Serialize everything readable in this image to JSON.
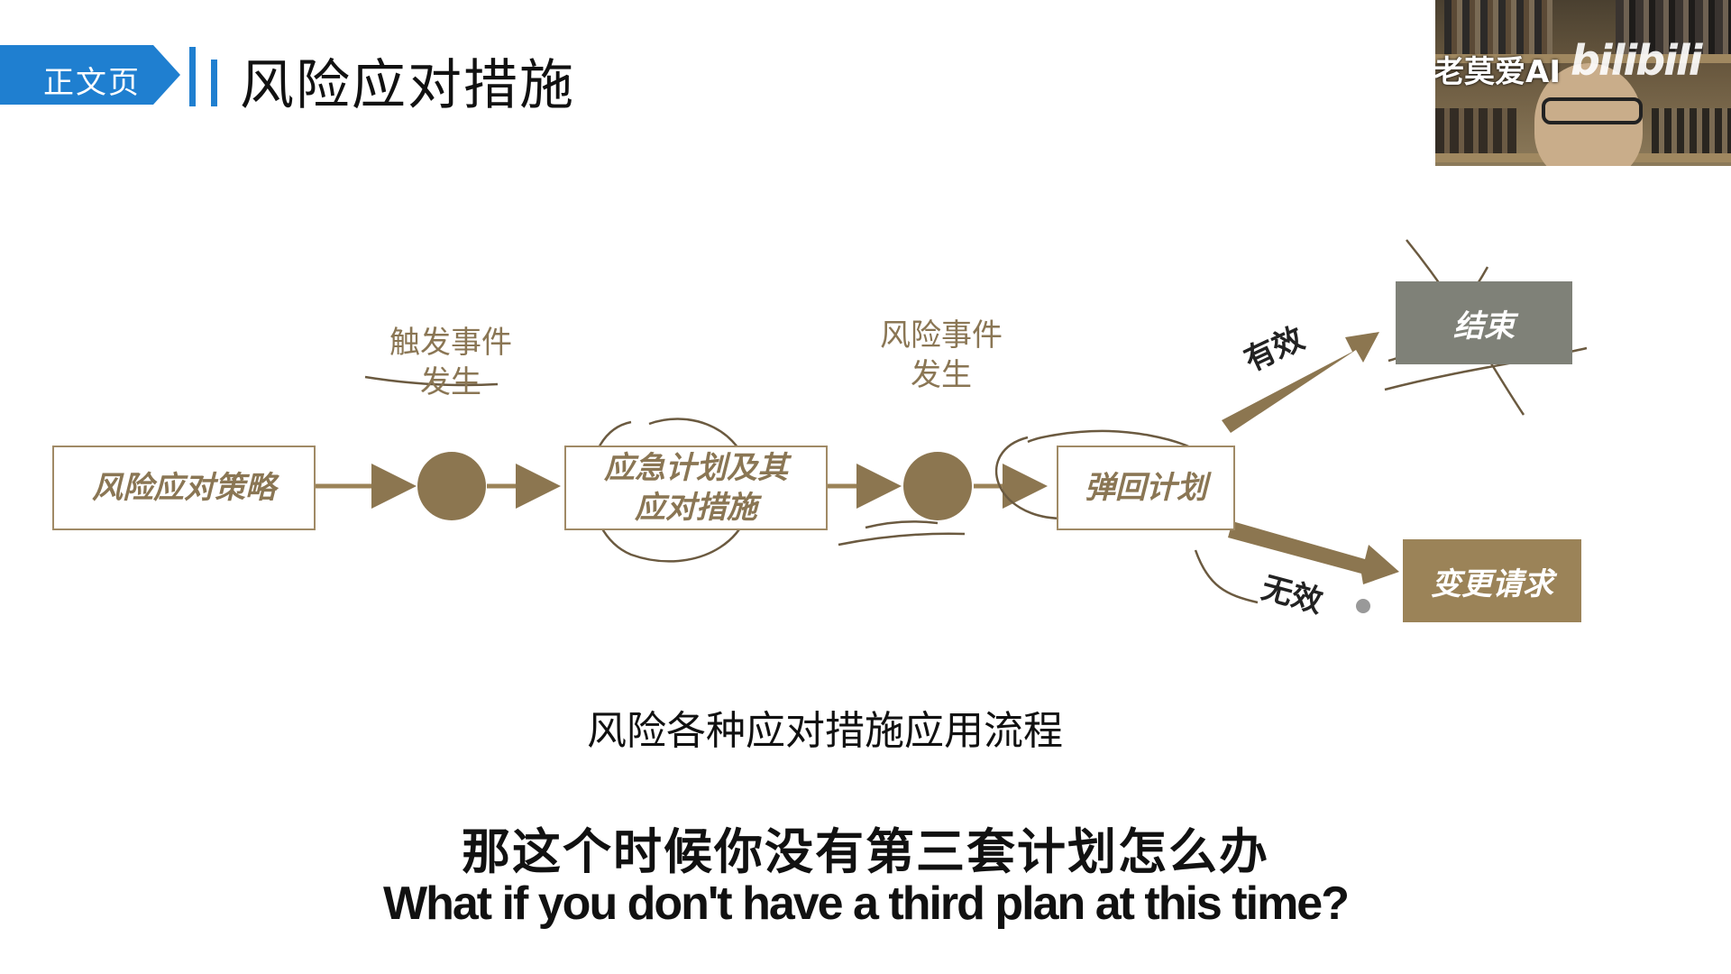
{
  "header": {
    "tag": "正文页",
    "title": "风险应对措施"
  },
  "webcam": {
    "owner": "老莫爱AI",
    "logo": "bilibili"
  },
  "diagram": {
    "box1": "风险应对策略",
    "trigger_label_line1": "触发事件",
    "trigger_label_line2": "发生",
    "box2_line1": "应急计划及其",
    "box2_line2": "应对措施",
    "risk_label_line1": "风险事件",
    "risk_label_line2": "发生",
    "box3": "弹回计划",
    "effective": "有效",
    "ineffective": "无效",
    "end": "结束",
    "change": "变更请求",
    "caption": "风险各种应对措施应用流程"
  },
  "subtitles": {
    "zh": "那这个时候你没有第三套计划怎么办",
    "en": "What if you don't have a third plan at this time?"
  },
  "colors": {
    "accent": "#1f7fd0",
    "brown": "#9b8358",
    "grey": "#7f8178"
  }
}
